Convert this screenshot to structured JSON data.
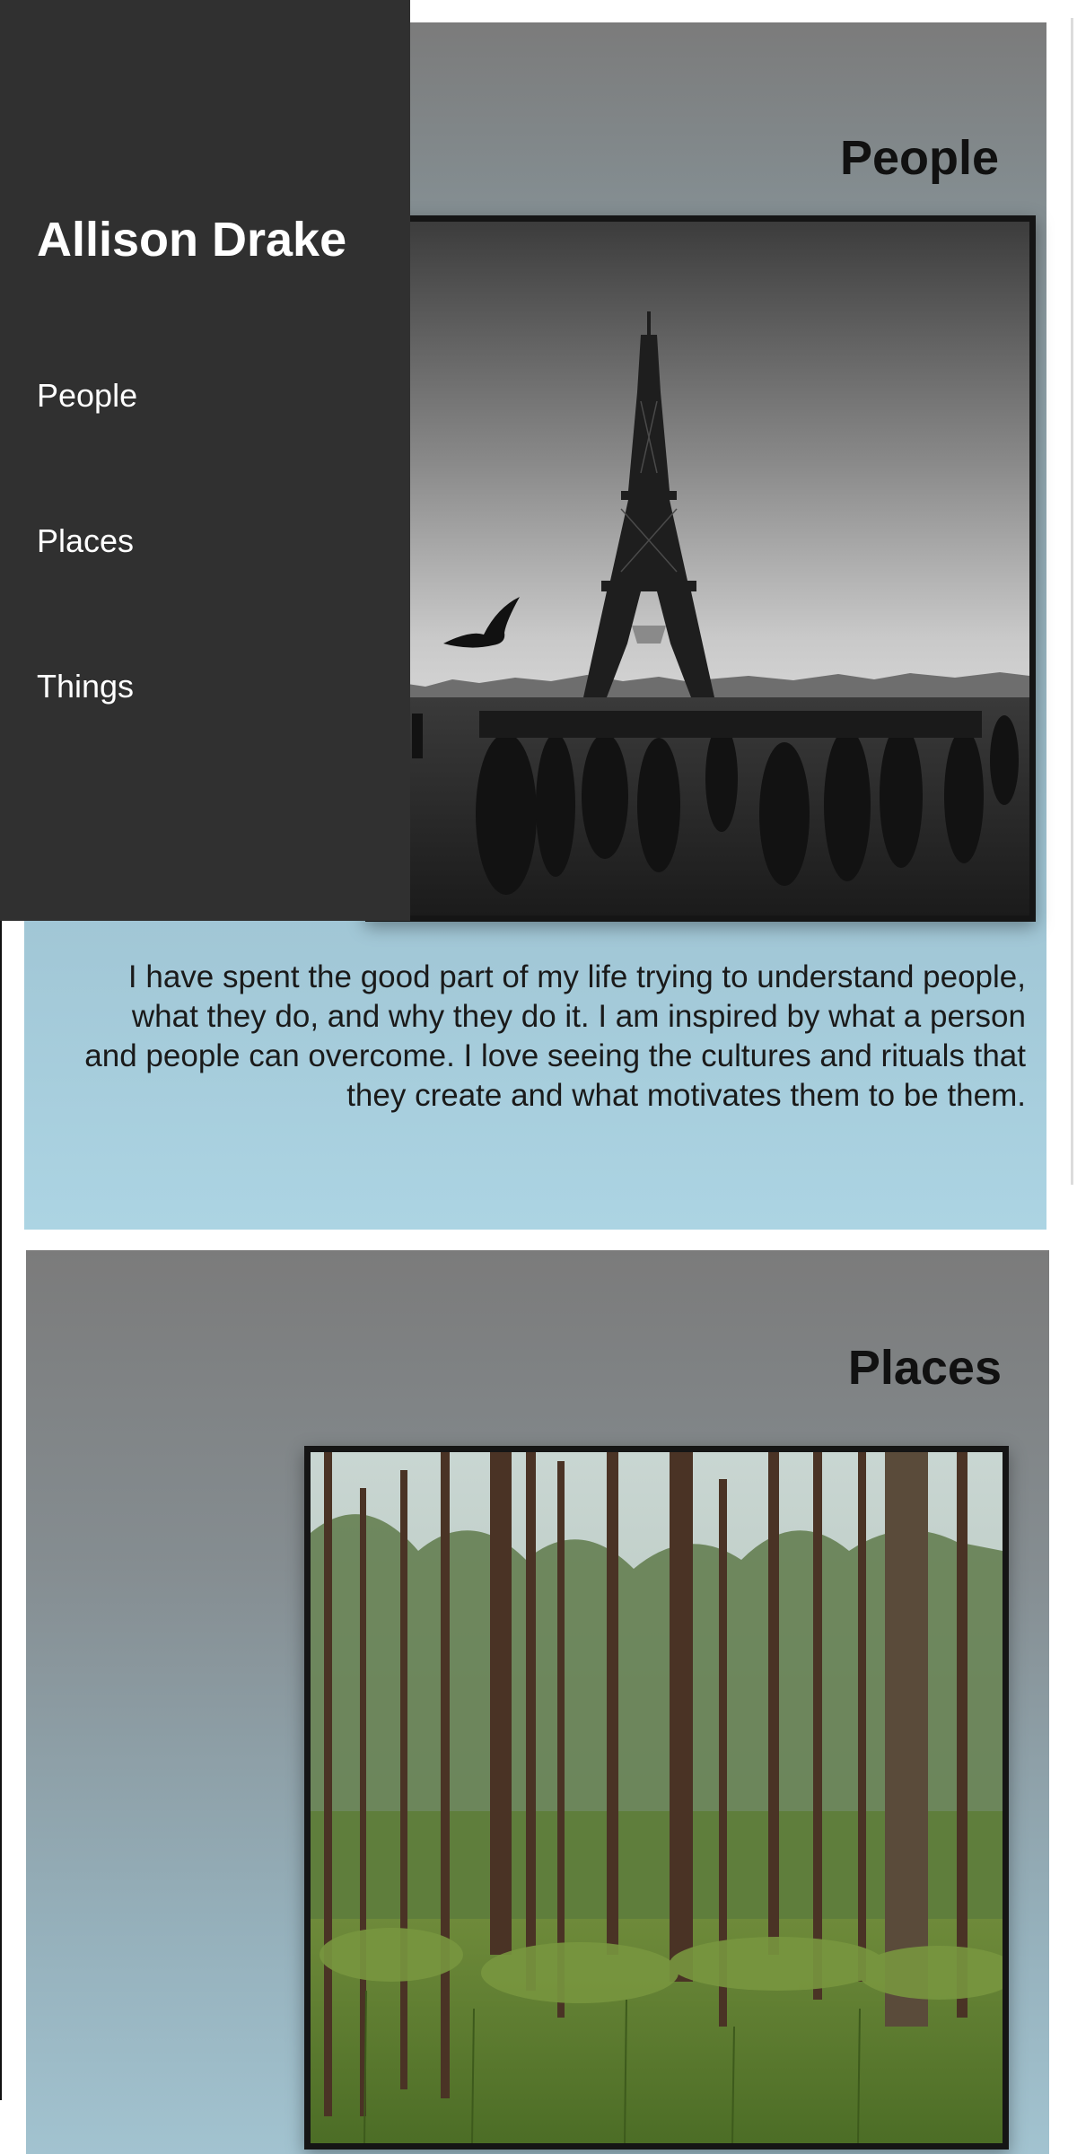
{
  "sidebar": {
    "title": "Allison Drake",
    "items": [
      {
        "label": "People"
      },
      {
        "label": "Places"
      },
      {
        "label": "Things"
      }
    ]
  },
  "sections": {
    "people": {
      "title": "People",
      "photo_icon": "eiffel-tower-photo",
      "bio": "I have spent the good part of my life trying to understand people, what they do, and why they do it. I am inspired by what a person and people can overcome. I love seeing the cultures and rituals that they create and what motivates them to be them."
    },
    "places": {
      "title": "Places",
      "photo_icon": "forest-photo"
    }
  },
  "colors": {
    "sidebar_bg": "#303030",
    "section_top": "#7b7b7b",
    "section_bottom": "#acd4e3",
    "text_dark": "#111111"
  }
}
